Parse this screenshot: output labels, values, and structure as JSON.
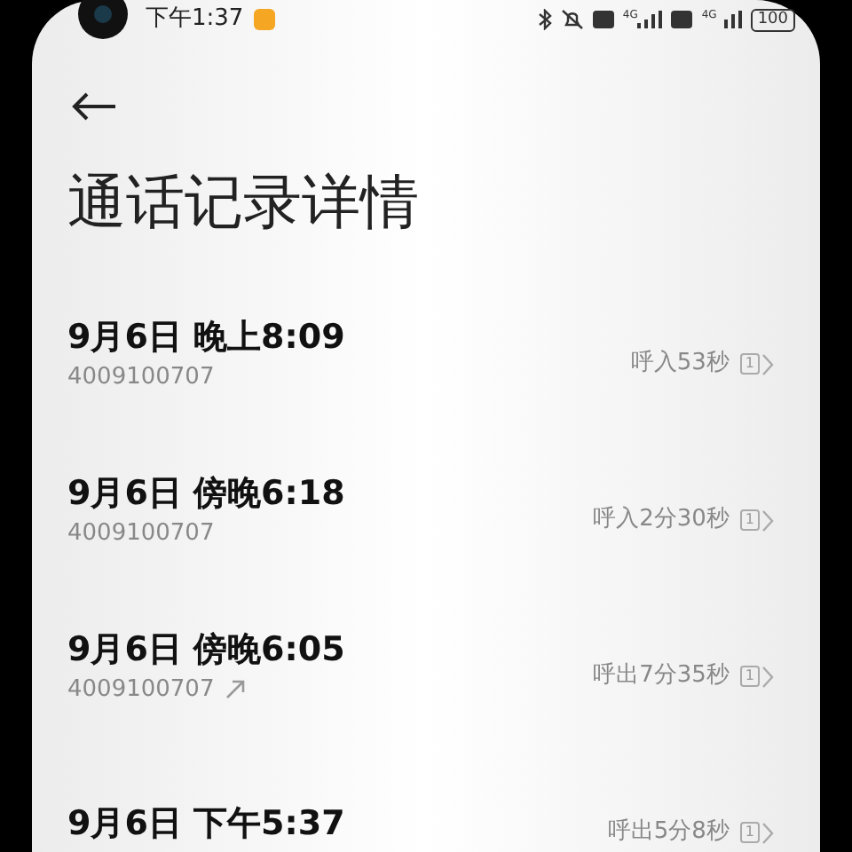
{
  "status_bar": {
    "time": "下午1:37",
    "signal_label": "4G",
    "signal_label_2": "4G",
    "battery": "100"
  },
  "title": "通话记录详情",
  "calls": [
    {
      "datetime": "9月6日 晚上8:09",
      "number": "4009100707",
      "outgoing": false,
      "duration": "呼入53秒",
      "sim": "1"
    },
    {
      "datetime": "9月6日 傍晚6:18",
      "number": "4009100707",
      "outgoing": false,
      "duration": "呼入2分30秒",
      "sim": "1"
    },
    {
      "datetime": "9月6日 傍晚6:05",
      "number": "4009100707",
      "outgoing": true,
      "duration": "呼出7分35秒",
      "sim": "1"
    },
    {
      "datetime": "9月6日 下午5:37",
      "duration": "呼出5分8秒",
      "sim": "1"
    }
  ]
}
